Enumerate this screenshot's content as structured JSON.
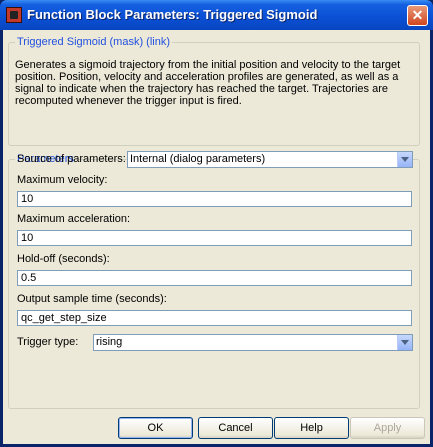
{
  "window": {
    "title": "Function Block Parameters: Triggered Sigmoid",
    "close_glyph": "✕",
    "icon": "simulink-block-icon"
  },
  "block": {
    "group_title": "Triggered Sigmoid (mask) (link)",
    "description": "Generates a sigmoid trajectory from the initial position and velocity to the target position. Position, velocity and acceleration profiles are generated, as well as a signal to indicate when the trajectory has reached the target. Trajectories are recomputed whenever the trigger input is fired."
  },
  "parameters": {
    "group_title": "Parameters",
    "source_label": "Source of parameters:",
    "source_value": "Internal (dialog parameters)",
    "max_velocity_label": "Maximum velocity:",
    "max_velocity_value": "10",
    "max_acceleration_label": "Maximum acceleration:",
    "max_acceleration_value": "10",
    "holdoff_label": "Hold-off (seconds):",
    "holdoff_value": "0.5",
    "sample_time_label": "Output sample time (seconds):",
    "sample_time_value": "qc_get_step_size",
    "trigger_label": "Trigger type:",
    "trigger_value": "rising"
  },
  "buttons": {
    "ok": "OK",
    "cancel": "Cancel",
    "help": "Help",
    "apply": "Apply"
  }
}
